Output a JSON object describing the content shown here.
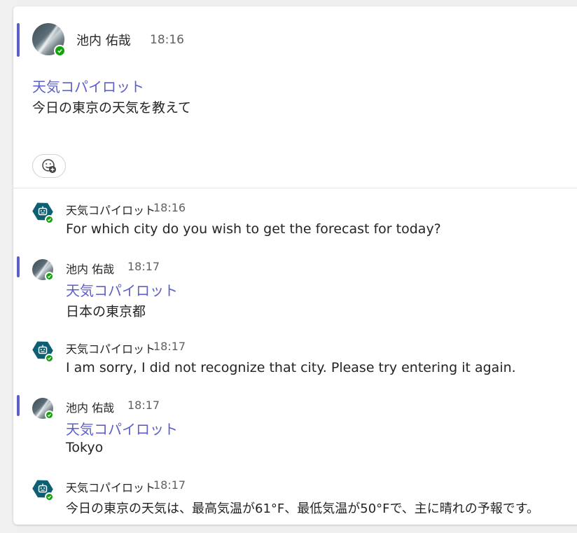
{
  "root_post": {
    "author": "池内 佑哉",
    "time": "18:16",
    "mention": "天気コパイロット",
    "text": "今日の東京の天気を教えて"
  },
  "replies": [
    {
      "author": "天気コパイロット",
      "time": "18:16",
      "text": "For which city do you wish to get the forecast for today?"
    },
    {
      "author": "池内 佑哉",
      "time": "18:17",
      "mention": "天気コパイロット",
      "text": "日本の東京都"
    },
    {
      "author": "天気コパイロット",
      "time": "18:17",
      "text": "I am sorry, I did not recognize that city. Please try entering it again."
    },
    {
      "author": "池内 佑哉",
      "time": "18:17",
      "mention": "天気コパイロット",
      "text": "Tokyo"
    },
    {
      "author": "天気コパイロット",
      "time": "18:17",
      "text": "今日の東京の天気は、最高気温が61°F、最低気温が50°Fで、主に晴れの予報です。"
    }
  ],
  "icons": {
    "reaction": "add-reaction-icon",
    "bot": "bot-icon",
    "presence": "available-presence-icon"
  },
  "colors": {
    "accent": "#5b5fc7",
    "presence": "#13a10e",
    "bot": "#0e5f73"
  }
}
